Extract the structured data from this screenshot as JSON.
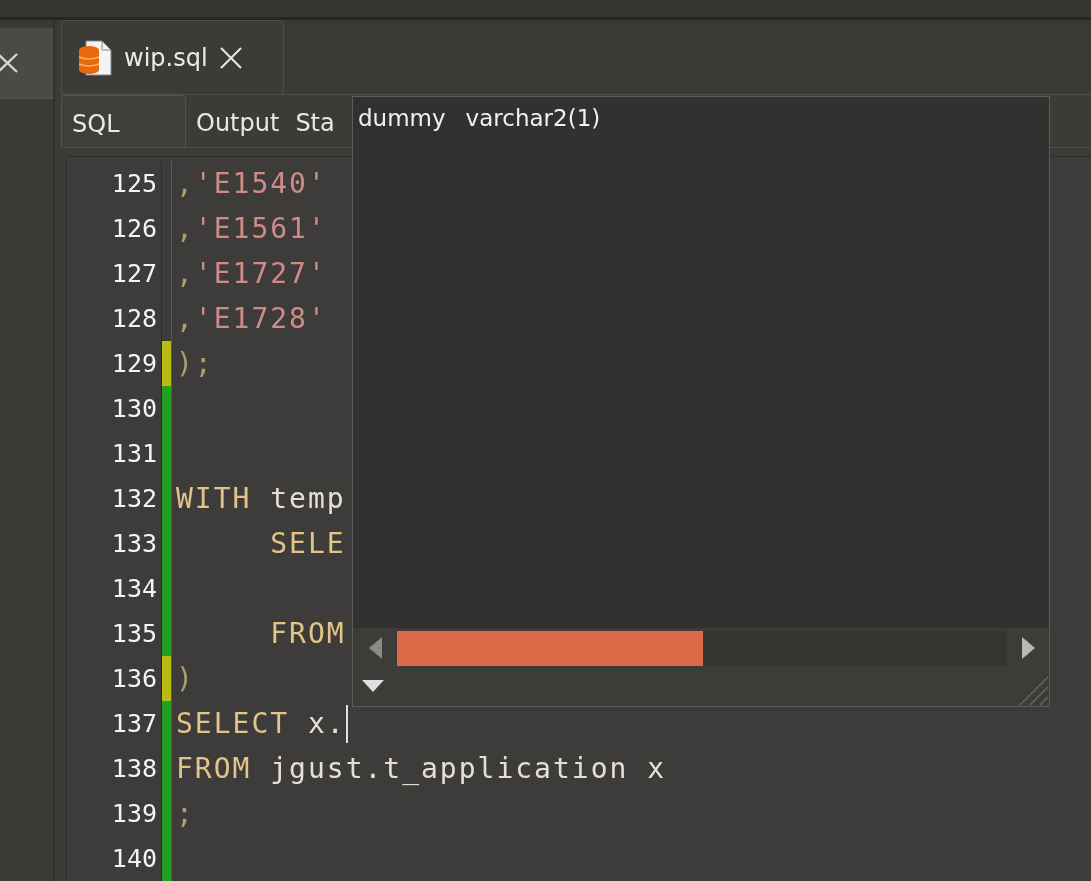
{
  "file_tab": {
    "title": "wip.sql"
  },
  "subtabs": [
    {
      "label": "SQL",
      "selected": true
    },
    {
      "label": "Output",
      "selected": false
    },
    {
      "label": "Sta",
      "selected": false
    }
  ],
  "editor": {
    "lines": [
      {
        "number": "125",
        "modified": false,
        "added": false,
        "tokens": [
          {
            "kind": "punct",
            "text": ","
          },
          {
            "kind": "string",
            "text": "'E1540'"
          }
        ]
      },
      {
        "number": "126",
        "modified": false,
        "added": false,
        "tokens": [
          {
            "kind": "punct",
            "text": ","
          },
          {
            "kind": "string",
            "text": "'E1561'"
          }
        ]
      },
      {
        "number": "127",
        "modified": false,
        "added": false,
        "tokens": [
          {
            "kind": "punct",
            "text": ","
          },
          {
            "kind": "string",
            "text": "'E1727'"
          }
        ]
      },
      {
        "number": "128",
        "modified": false,
        "added": false,
        "tokens": [
          {
            "kind": "punct",
            "text": ","
          },
          {
            "kind": "string",
            "text": "'E1728'"
          }
        ]
      },
      {
        "number": "129",
        "modified": true,
        "added": false,
        "tokens": [
          {
            "kind": "punct",
            "text": ");"
          }
        ]
      },
      {
        "number": "130",
        "modified": false,
        "added": true
      },
      {
        "number": "131",
        "modified": false,
        "added": true
      },
      {
        "number": "132",
        "modified": false,
        "added": true,
        "tokens": [
          {
            "kind": "keyword",
            "text": "WITH"
          },
          {
            "kind": "ident",
            "text": " temp"
          }
        ]
      },
      {
        "number": "133",
        "modified": false,
        "added": true,
        "tokens": [
          {
            "kind": "keyword",
            "text": "     SELE"
          }
        ]
      },
      {
        "number": "134",
        "modified": false,
        "added": true
      },
      {
        "number": "135",
        "modified": false,
        "added": true,
        "tokens": [
          {
            "kind": "keyword",
            "text": "     FROM"
          }
        ]
      },
      {
        "number": "136",
        "modified": true,
        "added": false,
        "tokens": [
          {
            "kind": "punct",
            "text": ")"
          }
        ]
      },
      {
        "number": "137",
        "modified": false,
        "added": true,
        "tokens": [
          {
            "kind": "keyword",
            "text": "SELECT"
          },
          {
            "kind": "ident",
            "text": " x."
          },
          {
            "kind": "caret"
          }
        ]
      },
      {
        "number": "138",
        "modified": false,
        "added": true,
        "tokens": [
          {
            "kind": "keyword",
            "text": "FROM"
          },
          {
            "kind": "ident",
            "text": " jgust.t_application x"
          }
        ]
      },
      {
        "number": "139",
        "modified": false,
        "added": true,
        "tokens": [
          {
            "kind": "punct",
            "text": ";"
          }
        ]
      },
      {
        "number": "140",
        "modified": false,
        "added": true
      }
    ]
  },
  "completion_popup": {
    "items": [
      {
        "name": "dummy",
        "type": "varchar2(1)",
        "selected": false
      }
    ]
  }
}
